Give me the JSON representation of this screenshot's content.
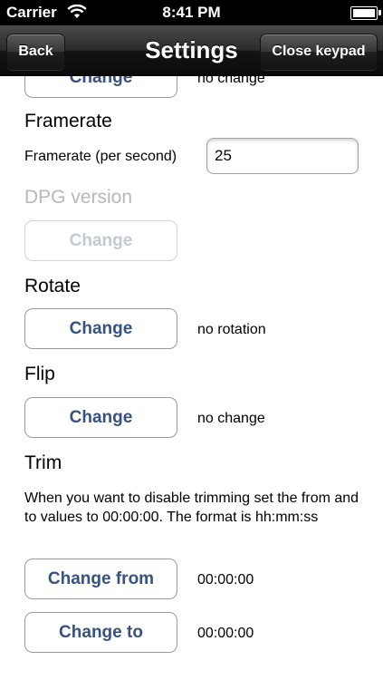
{
  "statusbar": {
    "carrier": "Carrier",
    "time": "8:41 PM"
  },
  "navbar": {
    "title": "Settings",
    "back_label": "Back",
    "close_label": "Close keypad"
  },
  "sections": {
    "top_partial": {
      "button_label": "Change",
      "value": "no change"
    },
    "framerate": {
      "title": "Framerate",
      "field_label": "Framerate (per second)",
      "field_value": "25"
    },
    "dpg_version": {
      "title": "DPG version",
      "button_label": "Change",
      "disabled": true
    },
    "rotate": {
      "title": "Rotate",
      "button_label": "Change",
      "value": "no rotation"
    },
    "flip": {
      "title": "Flip",
      "button_label": "Change",
      "value": "no change"
    },
    "trim": {
      "title": "Trim",
      "description": "When you want to disable trimming set the from and to values to 00:00:00. The format is hh:mm:ss",
      "from_label": "Change from",
      "from_value": "00:00:00",
      "to_label": "Change to",
      "to_value": "00:00:00"
    }
  },
  "colors": {
    "button_text": "#375182",
    "disabled_text": "#b8b8b8"
  }
}
